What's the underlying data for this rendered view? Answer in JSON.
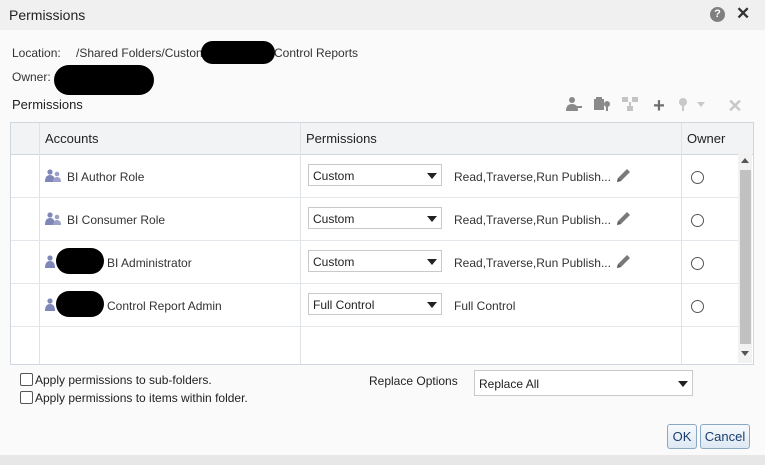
{
  "dialog": {
    "title": "Permissions",
    "help_icon": "help-icon",
    "close_icon": "close-icon",
    "location_label": "Location:",
    "location_value_start": "/Shared Folders/Custon",
    "location_value_end": "Control Reports",
    "owner_label": "Owner:"
  },
  "permissions_section": {
    "title": "Permissions",
    "toolbar_icons": [
      "add-user-icon",
      "add-application-role-icon",
      "hierarchy-icon",
      "add-icon",
      "key-menu-icon",
      "delete-icon"
    ],
    "columns": [
      "Accounts",
      "Permissions",
      "Owner"
    ],
    "rows": [
      {
        "account": "BI Author Role",
        "permission": "Custom",
        "details": "Read,Traverse,Run Publish...",
        "editable": true
      },
      {
        "account": "BI Consumer Role",
        "permission": "Custom",
        "details": "Read,Traverse,Run Publish...",
        "editable": true
      },
      {
        "account": "BI Administrator",
        "permission": "Custom",
        "details": "Read,Traverse,Run Publish...",
        "editable": true
      },
      {
        "account": "Control Report Admin",
        "permission": "Full Control",
        "details": "Full Control",
        "editable": false
      }
    ]
  },
  "options": {
    "apply_subfolders": "Apply permissions to sub-folders.",
    "apply_items": "Apply permissions to items within folder.",
    "replace_label": "Replace Options",
    "replace_value": "Replace All"
  },
  "buttons": {
    "ok": "OK",
    "cancel": "Cancel"
  },
  "colors": {
    "role_icon": "#7f86b8",
    "accent_border": "#8aa7c4",
    "button_text": "#1a3e6e"
  }
}
